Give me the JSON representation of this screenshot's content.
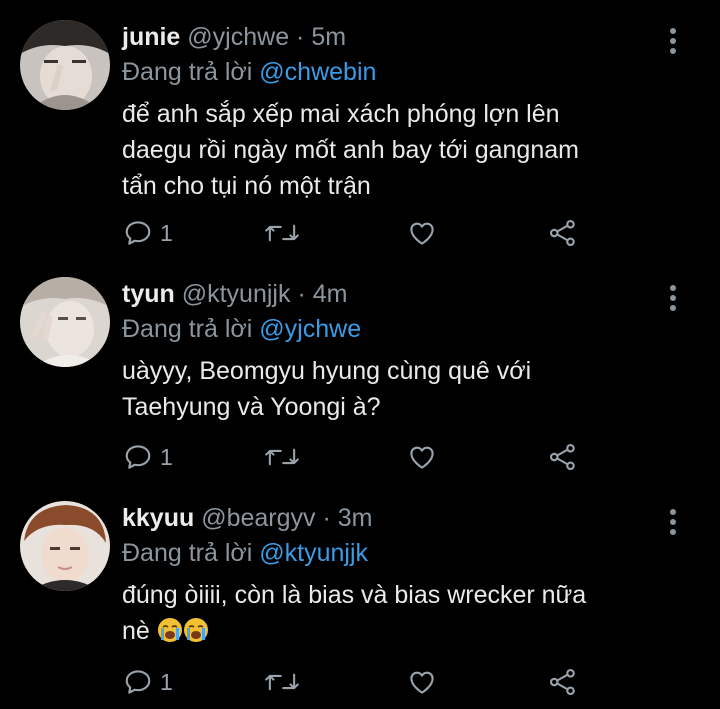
{
  "reply_prefix": "Đang trả lời",
  "tweets": [
    {
      "name": "junie",
      "handle": "@yjchwe",
      "separator": "·",
      "time": "5m",
      "reply_to": "@chwebin",
      "text": "để anh sắp xếp mai xách phóng lợn lên\ndaegu rồi ngày mốt anh bay tới gangnam\ntẩn cho tụi nó một trận",
      "reply_count": "1"
    },
    {
      "name": "tyun",
      "handle": "@ktyunjjk",
      "separator": "·",
      "time": "4m",
      "reply_to": "@yjchwe",
      "text": "uàyyy, Beomgyu hyung cùng quê với\nTaehyung và Yoongi à?",
      "reply_count": "1"
    },
    {
      "name": "kkyuu",
      "handle": "@beargyv",
      "separator": "·",
      "time": "3m",
      "reply_to": "@ktyunjjk",
      "text": "đúng òiiii, còn là bias và bias wrecker nữa\nnè",
      "reply_count": "1",
      "emojis": [
        "loudly-crying-face",
        "loudly-crying-face"
      ]
    }
  ],
  "icons": {
    "reply": "reply-icon",
    "retweet": "retweet-icon",
    "like": "heart-icon",
    "share": "share-icon",
    "more": "more-vertical-icon"
  },
  "colors": {
    "background": "#000000",
    "mention": "#3a9be6",
    "muted": "#8b959e",
    "text": "#eaeaea"
  }
}
